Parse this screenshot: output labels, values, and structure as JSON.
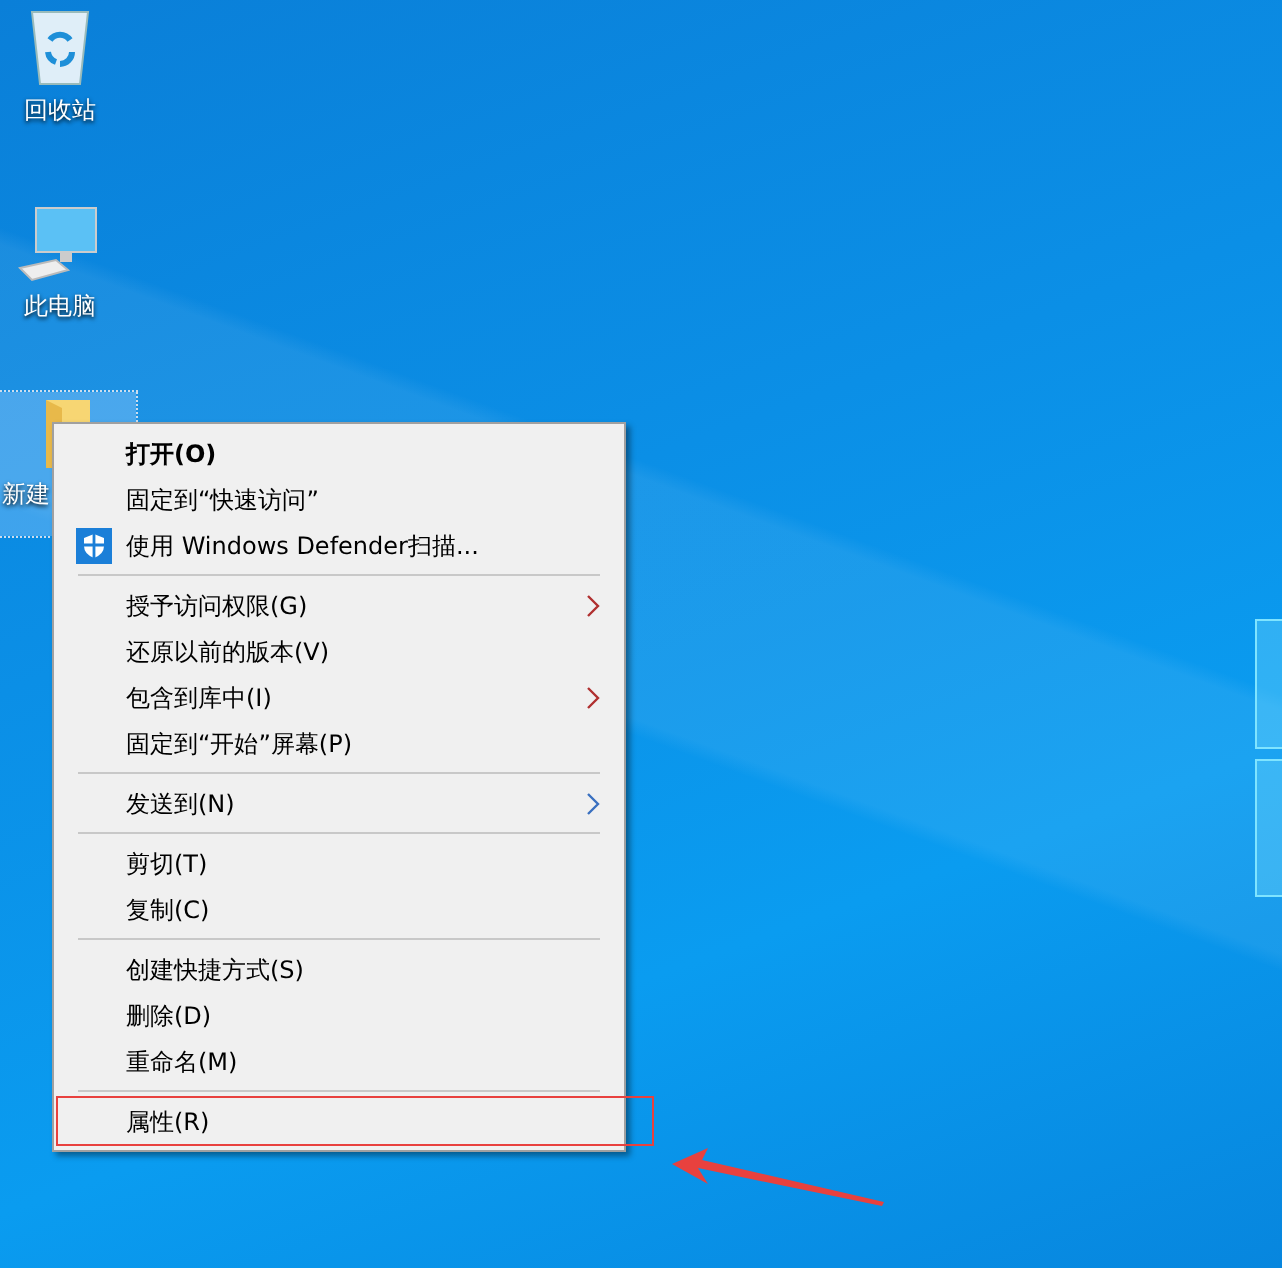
{
  "desktop_icons": [
    {
      "kind": "recycle_bin",
      "label": "回收站",
      "selected": false
    },
    {
      "kind": "computer",
      "label": "此电脑",
      "selected": false
    },
    {
      "kind": "folder",
      "label": "新建",
      "selected": true
    }
  ],
  "context_menu": {
    "items": [
      {
        "kind": "item",
        "label": "打开(O)",
        "default": true,
        "submenu": false,
        "highlighted": false
      },
      {
        "kind": "item",
        "label": "固定到“快速访问”",
        "default": false,
        "submenu": false,
        "highlighted": false
      },
      {
        "kind": "icon_item",
        "label": "使用 Windows Defender扫描...",
        "default": false,
        "submenu": false,
        "highlighted": false
      },
      {
        "kind": "separator"
      },
      {
        "kind": "item",
        "label": "授予访问权限(G)",
        "default": false,
        "submenu": true,
        "highlighted": false
      },
      {
        "kind": "item",
        "label": "还原以前的版本(V)",
        "default": false,
        "submenu": false,
        "highlighted": false
      },
      {
        "kind": "item",
        "label": "包含到库中(I)",
        "default": false,
        "submenu": true,
        "highlighted": false
      },
      {
        "kind": "item",
        "label": "固定到“开始”屏幕(P)",
        "default": false,
        "submenu": false,
        "highlighted": false
      },
      {
        "kind": "separator"
      },
      {
        "kind": "item",
        "label": "发送到(N)",
        "default": false,
        "submenu": true,
        "highlighted": false
      },
      {
        "kind": "separator"
      },
      {
        "kind": "item",
        "label": "剪切(T)",
        "default": false,
        "submenu": false,
        "highlighted": false
      },
      {
        "kind": "item",
        "label": "复制(C)",
        "default": false,
        "submenu": false,
        "highlighted": false
      },
      {
        "kind": "separator"
      },
      {
        "kind": "item",
        "label": "创建快捷方式(S)",
        "default": false,
        "submenu": false,
        "highlighted": false
      },
      {
        "kind": "item",
        "label": "删除(D)",
        "default": false,
        "submenu": false,
        "highlighted": false
      },
      {
        "kind": "item",
        "label": "重命名(M)",
        "default": false,
        "submenu": false,
        "highlighted": false
      },
      {
        "kind": "separator"
      },
      {
        "kind": "item",
        "label": "属性(R)",
        "default": false,
        "submenu": false,
        "highlighted": true
      }
    ]
  },
  "annotation_arrow": true
}
